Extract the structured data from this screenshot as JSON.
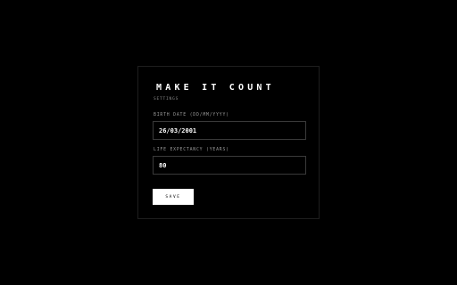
{
  "app": {
    "title": "MAKE IT COUNT",
    "subtitle": "SETTINGS"
  },
  "form": {
    "birth_date": {
      "label": "BIRTH DATE (DD/MM/YYYY)",
      "value": "26/03/2001"
    },
    "life_expectancy": {
      "label": "LIFE EXPECTANCY (YEARS)",
      "value": "80"
    },
    "save_label": "SAVE"
  },
  "colors": {
    "background": "#000000",
    "text": "#ffffff",
    "muted": "#8a8a8a",
    "border": "#3a3a3a",
    "button_bg": "#ffffff",
    "button_text": "#000000"
  }
}
